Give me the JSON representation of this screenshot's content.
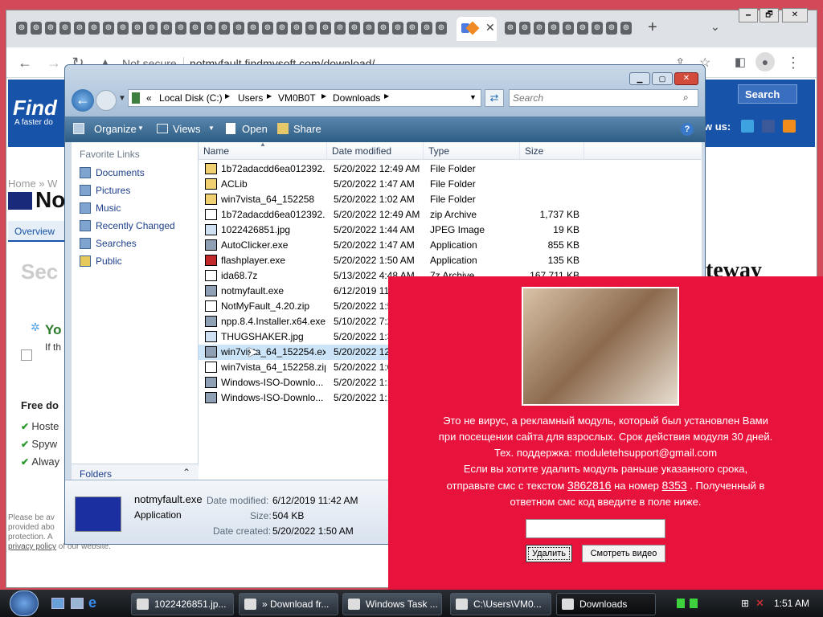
{
  "browser": {
    "tab_glyph": "⊚",
    "new_tab": "+",
    "not_secure": "Not secure",
    "url": "notmyfault.findmysoft.com/download/",
    "win_controls": [
      "🗕",
      "🗗",
      "✕"
    ]
  },
  "site": {
    "logo": "Find",
    "logo_tag": "A faster do",
    "search_label": "Search",
    "follow": "w us:",
    "breadcrumb": "Home » W",
    "title": "No",
    "tab_overview": "Overview",
    "section": "Sec",
    "gateway": "teway",
    "you": "Yo",
    "if_text": "If th",
    "free_dl": "Free do",
    "checks": [
      "Hoste",
      "Spyw",
      "Alway"
    ],
    "fine_print": [
      "Please be av",
      "provided abo",
      "protection. A",
      "privacy policy of our website."
    ]
  },
  "explorer": {
    "breadcrumb": [
      "«",
      "Local Disk (C:)",
      "Users",
      "VM0B0T",
      "Downloads"
    ],
    "search_placeholder": "Search",
    "toolbar": {
      "organize": "Organize",
      "views": "Views",
      "open": "Open",
      "share": "Share"
    },
    "favorites_title": "Favorite Links",
    "favorites": [
      "Documents",
      "Pictures",
      "Music",
      "Recently Changed",
      "Searches",
      "Public"
    ],
    "folders_label": "Folders",
    "columns": [
      "Name",
      "Date modified",
      "Type",
      "Size"
    ],
    "files": [
      {
        "name": "1b72adacdd6ea012392...",
        "date": "5/20/2022 12:49 AM",
        "type": "File Folder",
        "size": "",
        "icon": "folder"
      },
      {
        "name": "ACLib",
        "date": "5/20/2022 1:47 AM",
        "type": "File Folder",
        "size": "",
        "icon": "folder"
      },
      {
        "name": "win7vista_64_152258",
        "date": "5/20/2022 1:02 AM",
        "type": "File Folder",
        "size": "",
        "icon": "folder"
      },
      {
        "name": "1b72adacdd6ea012392...",
        "date": "5/20/2022 12:49 AM",
        "type": "zip Archive",
        "size": "1,737 KB",
        "icon": "zip"
      },
      {
        "name": "1022426851.jpg",
        "date": "5/20/2022 1:44 AM",
        "type": "JPEG Image",
        "size": "19 KB",
        "icon": "image"
      },
      {
        "name": "AutoClicker.exe",
        "date": "5/20/2022 1:47 AM",
        "type": "Application",
        "size": "855 KB",
        "icon": "app"
      },
      {
        "name": "flashplayer.exe",
        "date": "5/20/2022 1:50 AM",
        "type": "Application",
        "size": "135 KB",
        "icon": "flash"
      },
      {
        "name": "ida68.7z",
        "date": "5/13/2022 4:48 AM",
        "type": "7z Archive",
        "size": "167,711 KB",
        "icon": "zip"
      },
      {
        "name": "notmyfault.exe",
        "date": "6/12/2019 11:",
        "type": "",
        "size": "",
        "icon": "app"
      },
      {
        "name": "NotMyFault_4.20.zip",
        "date": "5/20/2022 1:5",
        "type": "",
        "size": "",
        "icon": "zip"
      },
      {
        "name": "npp.8.4.Installer.x64.exe",
        "date": "5/10/2022 7:2",
        "type": "",
        "size": "",
        "icon": "app"
      },
      {
        "name": "THUGSHAKER.jpg",
        "date": "5/20/2022 1:3",
        "type": "",
        "size": "",
        "icon": "image"
      },
      {
        "name": "win7vista_64_152254.exe",
        "date": "5/20/2022 12:",
        "type": "",
        "size": "",
        "icon": "app",
        "selected": true
      },
      {
        "name": "win7vista_64_152258.zip",
        "date": "5/20/2022 1:0",
        "type": "",
        "size": "",
        "icon": "zip"
      },
      {
        "name": "Windows-ISO-Downlo...",
        "date": "5/20/2022 1:1",
        "type": "",
        "size": "",
        "icon": "app"
      },
      {
        "name": "Windows-ISO-Downlo...",
        "date": "5/20/2022 1:1",
        "type": "",
        "size": "",
        "icon": "app"
      }
    ],
    "details": {
      "name": "notmyfault.exe",
      "kind": "Application",
      "modified_label": "Date modified:",
      "modified": "6/12/2019 11:42 AM",
      "size_label": "Size:",
      "size": "504 KB",
      "created_label": "Date created:",
      "created": "5/20/2022 1:50 AM"
    }
  },
  "popup": {
    "lines": [
      "Это не вирус, а рекламный модуль, который был установлен Вами",
      "при посещении сайта для взрослых. Срок действия модуля 30 дней.",
      "Тех. поддержка: moduletehsupport@gmail.com",
      "Если вы хотите удалить модуль раньше указанного срока,"
    ],
    "line5_pre": "отправьте смс с текстом",
    "sms_text": "3862816",
    "line5_mid": "на номер",
    "sms_number": "8353",
    "line5_post": ". Полученный в",
    "line6": "ответном смс код введите в поле ниже.",
    "input_value": "",
    "delete_btn": "Удалить",
    "video_btn": "Смотреть видео"
  },
  "taskbar": {
    "items": [
      "1022426851.jp...",
      "» Download fr...",
      "Windows Task ...",
      "C:\\Users\\VM0...",
      "Downloads"
    ],
    "clock": "1:51 AM"
  },
  "colors": {
    "popup_bg": "#e8133c",
    "accent": "#1e3f8a"
  }
}
